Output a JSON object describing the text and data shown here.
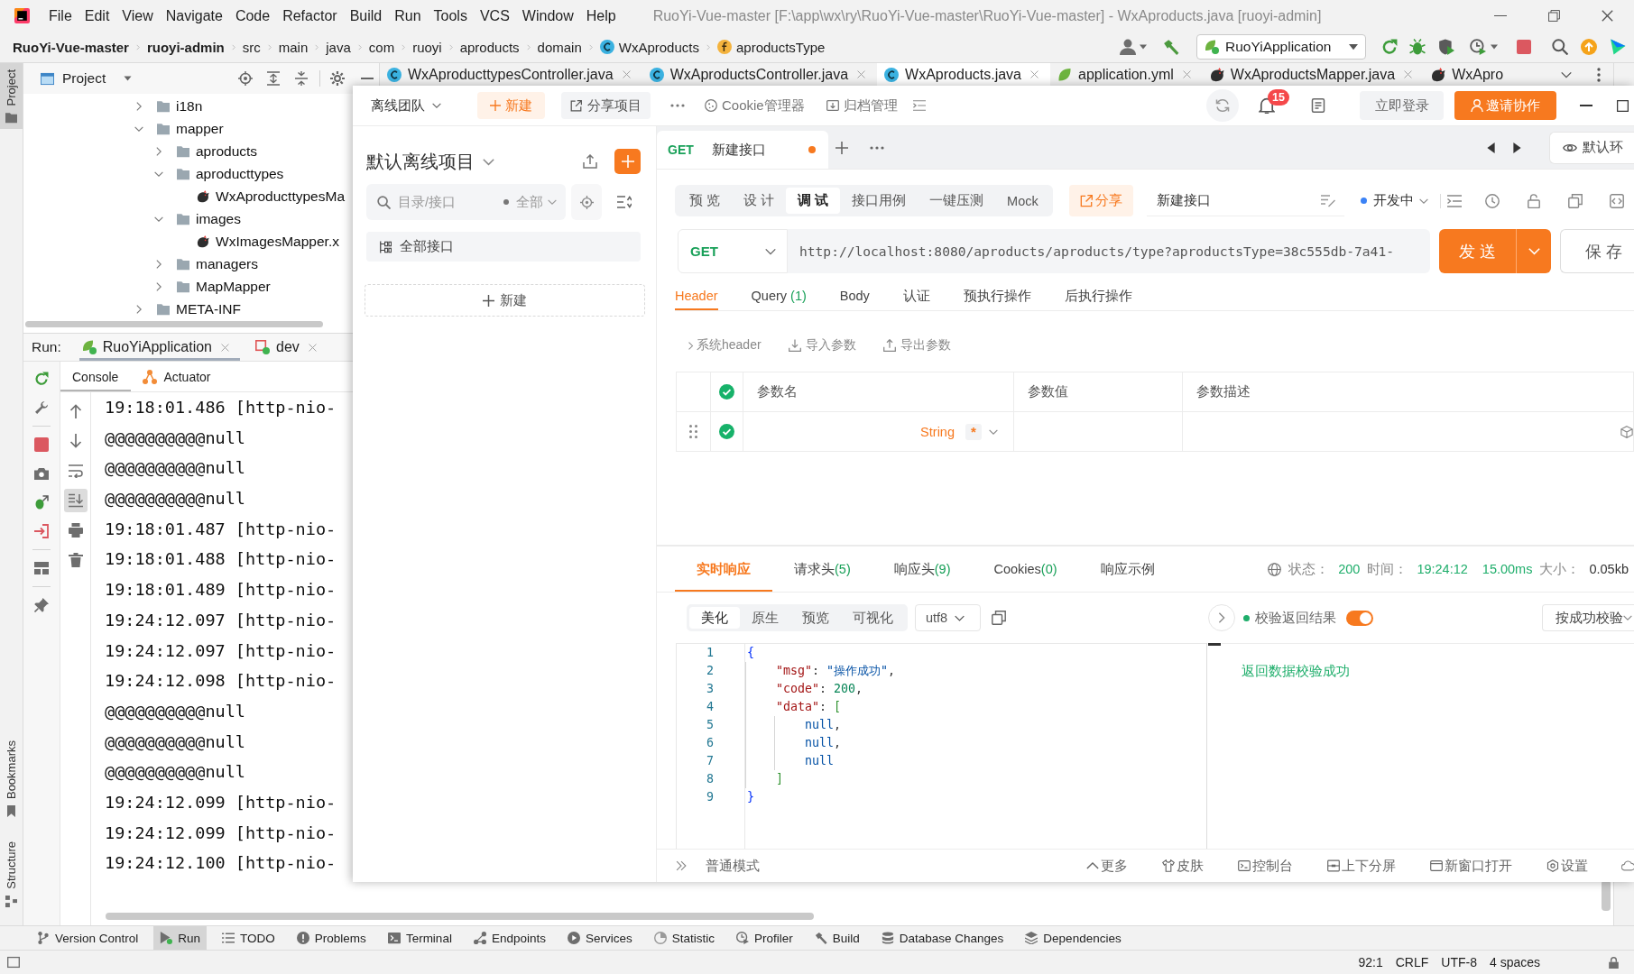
{
  "ide": {
    "menu": [
      "File",
      "Edit",
      "View",
      "Navigate",
      "Code",
      "Refactor",
      "Build",
      "Run",
      "Tools",
      "VCS",
      "Window",
      "Help"
    ],
    "window_title": "RuoYi-Vue-master [F:\\app\\wx\\ry\\RuoYi-Vue-master\\RuoYi-Vue-master] - WxAproducts.java [ruoyi-admin]",
    "breadcrumbs": [
      {
        "label": "RuoYi-Vue-master",
        "kind": "module"
      },
      {
        "label": "ruoyi-admin",
        "kind": "module"
      },
      {
        "label": "src",
        "kind": "package"
      },
      {
        "label": "main",
        "kind": "package"
      },
      {
        "label": "java",
        "kind": "package"
      },
      {
        "label": "com",
        "kind": "package"
      },
      {
        "label": "ruoyi",
        "kind": "package"
      },
      {
        "label": "aproducts",
        "kind": "package"
      },
      {
        "label": "domain",
        "kind": "package"
      },
      {
        "label": "WxAproducts",
        "kind": "class"
      },
      {
        "label": "aproductsType",
        "kind": "field"
      }
    ],
    "run_configuration": "RuoYiApplication",
    "editor_tabs": [
      {
        "label": "WxAproducttypesController.java",
        "kind": "class",
        "selected": false,
        "closable": true
      },
      {
        "label": "WxAproductsController.java",
        "kind": "class",
        "selected": false,
        "closable": true
      },
      {
        "label": "WxAproducts.java",
        "kind": "class",
        "selected": true,
        "closable": true
      },
      {
        "label": "application.yml",
        "kind": "yaml",
        "selected": false,
        "closable": true
      },
      {
        "label": "WxAproductsMapper.java",
        "kind": "mapper",
        "selected": false,
        "closable": true
      },
      {
        "label": "WxApro",
        "kind": "mapper",
        "selected": false,
        "closable": false
      }
    ],
    "side_tabs": [
      {
        "label": "Project",
        "kind": "project",
        "selected": true
      },
      {
        "label": "Bookmarks",
        "kind": "bookmarks",
        "selected": false
      },
      {
        "label": "Structure",
        "kind": "structure",
        "selected": false
      }
    ],
    "project_panel": {
      "title": "Project",
      "tree": [
        {
          "label": "i18n",
          "kind": "folder",
          "expanded": false
        },
        {
          "label": "mapper",
          "kind": "folder",
          "expanded": true,
          "children": [
            {
              "label": "aproducts",
              "kind": "folder",
              "expanded": false
            },
            {
              "label": "aproducttypes",
              "kind": "folder",
              "expanded": true,
              "children": [
                {
                  "label": "WxAproducttypesMa",
                  "kind": "file"
                }
              ]
            },
            {
              "label": "images",
              "kind": "folder",
              "expanded": true,
              "children": [
                {
                  "label": "WxImagesMapper.x",
                  "kind": "file"
                }
              ]
            },
            {
              "label": "managers",
              "kind": "folder",
              "expanded": false
            },
            {
              "label": "MapMapper",
              "kind": "folder",
              "expanded": false
            }
          ]
        },
        {
          "label": "META-INF",
          "kind": "folder",
          "expanded": false
        }
      ]
    },
    "run_panel": {
      "title": "Run:",
      "tabs": [
        {
          "label": "RuoYiApplication",
          "kind": "spring",
          "selected": true
        },
        {
          "label": "dev",
          "kind": "config",
          "selected": false
        }
      ],
      "console_tabs": [
        {
          "label": "Console",
          "kind": "console",
          "selected": true
        },
        {
          "label": "Actuator",
          "kind": "actuator",
          "selected": false
        }
      ],
      "scroll_to_end": true,
      "lines": [
        "19:18:01.486 [http-nio-",
        "@@@@@@@@@@null",
        "@@@@@@@@@@null",
        "@@@@@@@@@@null",
        "19:18:01.487 [http-nio-",
        "19:18:01.488 [http-nio-",
        "19:18:01.489 [http-nio-",
        "19:24:12.097 [http-nio-",
        "19:24:12.097 [http-nio-",
        "19:24:12.098 [http-nio-",
        "@@@@@@@@@@null",
        "@@@@@@@@@@null",
        "@@@@@@@@@@null",
        "19:24:12.099 [http-nio-",
        "19:24:12.099 [http-nio-",
        "19:24:12.100 [http-nio-"
      ]
    },
    "tool_windows": [
      {
        "label": "Version Control",
        "kind": "vcs",
        "selected": false
      },
      {
        "label": "Run",
        "kind": "run",
        "selected": true
      },
      {
        "label": "TODO",
        "kind": "todo",
        "selected": false
      },
      {
        "label": "Problems",
        "kind": "problems",
        "selected": false
      },
      {
        "label": "Terminal",
        "kind": "terminal",
        "selected": false
      },
      {
        "label": "Endpoints",
        "kind": "endpoints",
        "selected": false
      },
      {
        "label": "Services",
        "kind": "services",
        "selected": false
      },
      {
        "label": "Statistic",
        "kind": "statistic",
        "selected": false
      },
      {
        "label": "Profiler",
        "kind": "profiler",
        "selected": false
      },
      {
        "label": "Build",
        "kind": "build",
        "selected": false
      },
      {
        "label": "Database Changes",
        "kind": "database",
        "selected": false
      },
      {
        "label": "Dependencies",
        "kind": "dependencies",
        "selected": false
      }
    ],
    "status_bar": [
      "92:1",
      "CRLF",
      "UTF-8",
      "4 spaces"
    ]
  },
  "apifox": {
    "header": {
      "team": "离线团队",
      "new": "新建",
      "share_project": "分享项目",
      "cookie_manager": "Cookie管理器",
      "archive": "归档管理",
      "notifications": "15",
      "login": "立即登录",
      "invite": "邀请协作"
    },
    "sidebar": {
      "project": "默认离线项目",
      "search": {
        "placeholder": "目录/接口"
      },
      "filter": "全部",
      "all_apis": "全部接口",
      "new": "新建"
    },
    "tabs": [
      {
        "method": "GET",
        "label": "新建接口",
        "unsaved": true,
        "selected": true
      }
    ],
    "environment": "默认环",
    "mode_tabs": [
      {
        "label": "预 览",
        "selected": false
      },
      {
        "label": "设 计",
        "selected": false
      },
      {
        "label": "调 试",
        "selected": true
      },
      {
        "label": "接口用例",
        "selected": false
      },
      {
        "label": "一键压测",
        "selected": false
      },
      {
        "label": "Mock",
        "selected": false
      }
    ],
    "share": "分享",
    "api_name": "新建接口",
    "api_status": "开发中",
    "request": {
      "method": "GET",
      "url": "http://localhost:8080/aproducts/aproducts/type?aproductsType=38c555db-7a41-",
      "send": "发 送",
      "save": "保 存"
    },
    "param_tabs": [
      {
        "label": "Header",
        "selected": true
      },
      {
        "label": "Query",
        "count": "(1)",
        "selected": false
      },
      {
        "label": "Body",
        "selected": false
      },
      {
        "label": "认证",
        "selected": false
      },
      {
        "label": "预执行操作",
        "selected": false
      },
      {
        "label": "后执行操作",
        "selected": false
      }
    ],
    "param_actions": [
      {
        "label": "系统header",
        "kind": "expand"
      },
      {
        "label": "导入参数",
        "kind": "import"
      },
      {
        "label": "导出参数",
        "kind": "export"
      }
    ],
    "params_table": {
      "columns": [
        "参数名",
        "参数值",
        "参数描述"
      ],
      "all_enabled": true,
      "rows": [
        {
          "enabled": true,
          "type": "String",
          "required_mark": "*"
        }
      ]
    },
    "response": {
      "tabs": [
        {
          "label": "实时响应",
          "selected": true
        },
        {
          "label": "请求头",
          "count": "(5)",
          "selected": false
        },
        {
          "label": "响应头",
          "count": "(9)",
          "selected": false
        },
        {
          "label": "Cookies",
          "count": "(0)",
          "selected": false
        },
        {
          "label": "响应示例",
          "selected": false
        }
      ],
      "status_label": "状态：",
      "status": "200",
      "time_label": "时间：",
      "time": "19:24:12",
      "duration": "15.00ms",
      "size_label": "大小：",
      "size": "0.05kb",
      "view_tabs": [
        {
          "label": "美化",
          "selected": true
        },
        {
          "label": "原生",
          "selected": false
        },
        {
          "label": "预览",
          "selected": false
        },
        {
          "label": "可视化",
          "selected": false
        }
      ],
      "encoding": "utf8",
      "body": [
        {
          "no": "1",
          "tokens": [
            {
              "kind": "brace",
              "text": "{"
            }
          ],
          "children": [
            {
              "no": "2",
              "tokens": [
                {
                  "kind": "key",
                  "text": "\"msg\""
                },
                {
                  "kind": "punct",
                  "text": ": "
                },
                {
                  "kind": "string",
                  "text": "\"操作成功\""
                },
                {
                  "kind": "punct",
                  "text": ","
                }
              ]
            },
            {
              "no": "3",
              "tokens": [
                {
                  "kind": "key",
                  "text": "\"code\""
                },
                {
                  "kind": "punct",
                  "text": ": "
                },
                {
                  "kind": "number",
                  "text": "200"
                },
                {
                  "kind": "punct",
                  "text": ","
                }
              ]
            },
            {
              "no": "4",
              "tokens": [
                {
                  "kind": "key",
                  "text": "\"data\""
                },
                {
                  "kind": "punct",
                  "text": ": "
                },
                {
                  "kind": "bracket",
                  "text": "["
                }
              ],
              "children": [
                {
                  "no": "5",
                  "tokens": [
                    {
                      "kind": "null",
                      "text": "null"
                    },
                    {
                      "kind": "punct",
                      "text": ","
                    }
                  ]
                },
                {
                  "no": "6",
                  "tokens": [
                    {
                      "kind": "null",
                      "text": "null"
                    },
                    {
                      "kind": "punct",
                      "text": ","
                    }
                  ]
                },
                {
                  "no": "7",
                  "tokens": [
                    {
                      "kind": "null",
                      "text": "null"
                    }
                  ]
                }
              ]
            },
            {
              "no": "8",
              "tokens": [
                {
                  "kind": "bracket",
                  "text": "]"
                }
              ]
            }
          ]
        },
        {
          "no": "9",
          "tokens": [
            {
              "kind": "brace",
              "text": "}"
            }
          ]
        }
      ],
      "validation": {
        "label": "校验返回结果",
        "on": true,
        "mode": "按成功校验",
        "result": "返回数据校验成功"
      }
    },
    "footer": {
      "mode": "普通模式",
      "actions": [
        {
          "label": "更多",
          "kind": "more"
        },
        {
          "label": "皮肤",
          "kind": "skin"
        },
        {
          "label": "控制台",
          "kind": "console"
        },
        {
          "label": "上下分屏",
          "kind": "split"
        },
        {
          "label": "新窗口打开",
          "kind": "window"
        },
        {
          "label": "设置",
          "kind": "settings"
        }
      ]
    }
  }
}
